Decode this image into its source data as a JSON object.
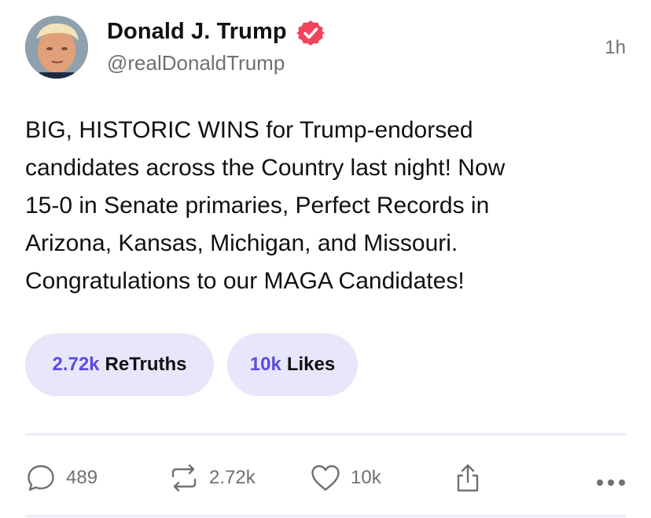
{
  "author": {
    "display_name": "Donald J. Trump",
    "handle": "@realDonaldTrump",
    "verified": true
  },
  "timestamp": "1h",
  "post_text": "BIG, HISTORIC WINS for Trump-endorsed\ncandidates across the Country last night! Now\n15-0 in Senate primaries, Perfect Records in\nArizona, Kansas, Michigan, and Missouri.\nCongratulations to our MAGA Candidates!",
  "stats": {
    "retruths_count": "2.72k",
    "retruths_label": "ReTruths",
    "likes_count": "10k",
    "likes_label": "Likes"
  },
  "actions": {
    "reply_count": "489",
    "retruth_count": "2.72k",
    "like_count": "10k"
  },
  "icons": {
    "reply": "speech-bubble-icon",
    "retruth": "repost-arrows-icon",
    "like": "heart-icon",
    "share": "share-icon",
    "more": "more-dots-icon",
    "verified": "verified-badge-icon"
  },
  "colors": {
    "accent": "#5b4ce0",
    "pill_background": "#e8e6fb",
    "verified_badge": "#f2435b",
    "muted_text": "#707070",
    "divider": "#ecebfb"
  }
}
